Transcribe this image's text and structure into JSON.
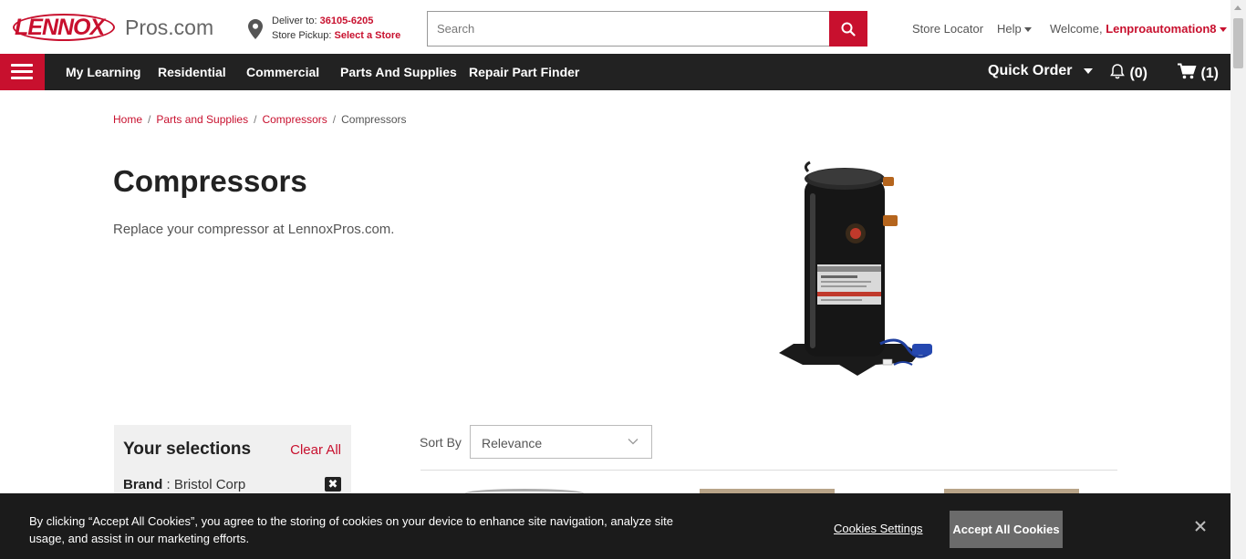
{
  "header": {
    "logo_brand": "LENNOX",
    "logo_suffix": "Pros.com",
    "deliver_label": "Deliver to:",
    "deliver_zip": "36105-6205",
    "pickup_label": "Store Pickup:",
    "pickup_link": "Select a Store",
    "search_placeholder": "Search",
    "store_locator": "Store Locator",
    "help": "Help",
    "welcome_label": "Welcome,",
    "user_name": "Lenproautomation8"
  },
  "nav": {
    "items": [
      "My Learning",
      "Residential",
      "Commercial",
      "Parts And Supplies",
      "Repair Part Finder"
    ],
    "quick_order": "Quick Order",
    "notifications": "(0)",
    "cart": "(1)"
  },
  "breadcrumb": [
    "Home",
    "Parts and Supplies",
    "Compressors",
    "Compressors"
  ],
  "page": {
    "title": "Compressors",
    "description": "Replace your compressor at LennoxPros.com."
  },
  "selections": {
    "title": "Your selections",
    "clear_all": "Clear All",
    "filter_label": "Brand",
    "filter_value": "Bristol Corp"
  },
  "sort": {
    "label": "Sort By",
    "value": "Relevance"
  },
  "cookie": {
    "text": "By clicking “Accept All Cookies”, you agree to the storing of cookies on your device to enhance site navigation, analyze site usage, and assist in our marketing efforts.",
    "settings": "Cookies Settings",
    "accept": "Accept All Cookies"
  },
  "colors": {
    "brand_red": "#c8102e",
    "nav_bg": "#222222",
    "cookie_bg": "#1b1b1b"
  }
}
